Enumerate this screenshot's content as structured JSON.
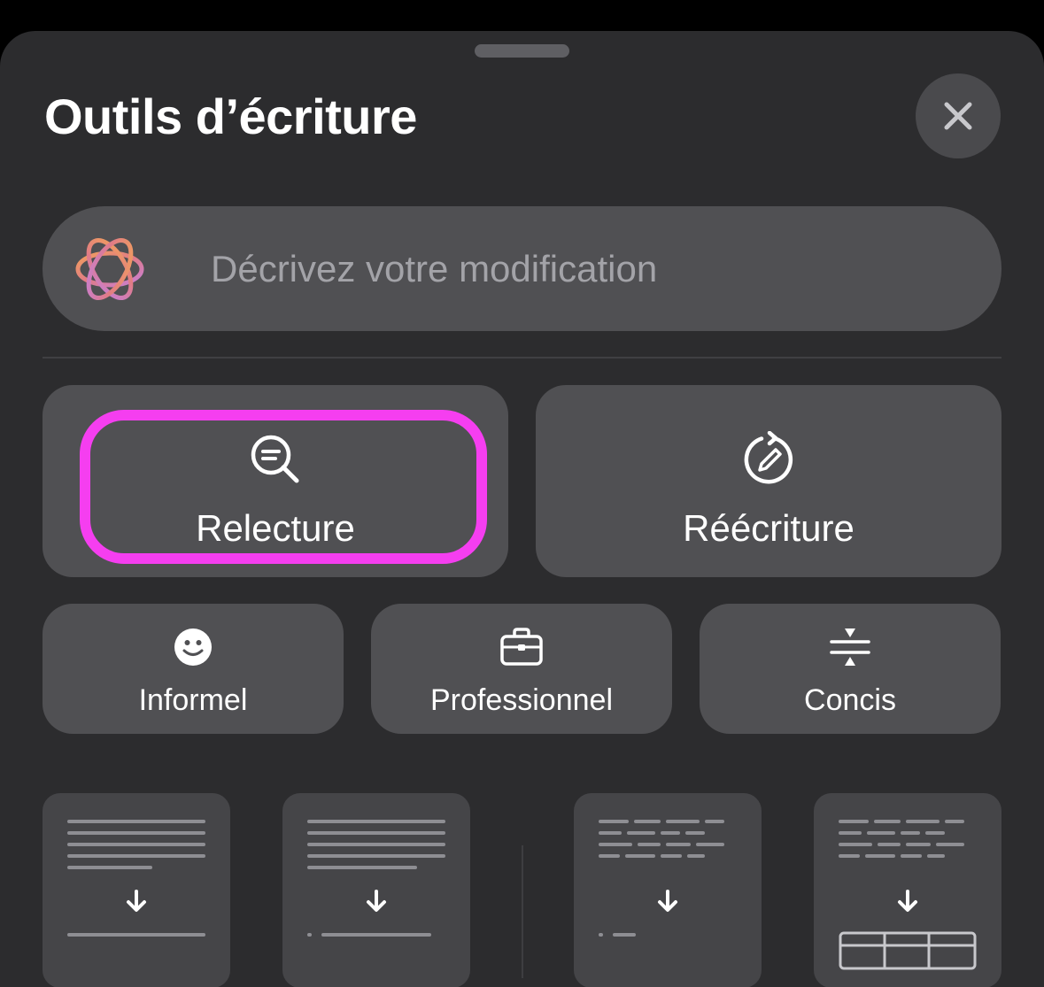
{
  "sheet": {
    "title": "Outils d’écriture",
    "close_icon": "close-icon"
  },
  "prompt": {
    "placeholder": "Décrivez votre modification",
    "icon": "apple-intelligence-icon"
  },
  "primary_tools": [
    {
      "label": "Relecture",
      "icon": "magnifier-text-icon",
      "highlighted": true
    },
    {
      "label": "Réécriture",
      "icon": "rewrite-pencil-icon",
      "highlighted": false
    }
  ],
  "tone_tools": [
    {
      "label": "Informel",
      "icon": "smiley-icon"
    },
    {
      "label": "Professionnel",
      "icon": "briefcase-icon"
    },
    {
      "label": "Concis",
      "icon": "compress-icon"
    }
  ],
  "format_tools": [
    {
      "icon": "summary-doc-icon"
    },
    {
      "icon": "key-points-doc-icon"
    },
    {
      "icon": "list-doc-icon"
    },
    {
      "icon": "table-doc-icon"
    }
  ],
  "colors": {
    "sheet_background": "#2c2c2e",
    "button_background": "#505053",
    "highlight": "#f53ef0",
    "text_primary": "#ffffff",
    "text_placeholder": "#a3a3a8"
  }
}
